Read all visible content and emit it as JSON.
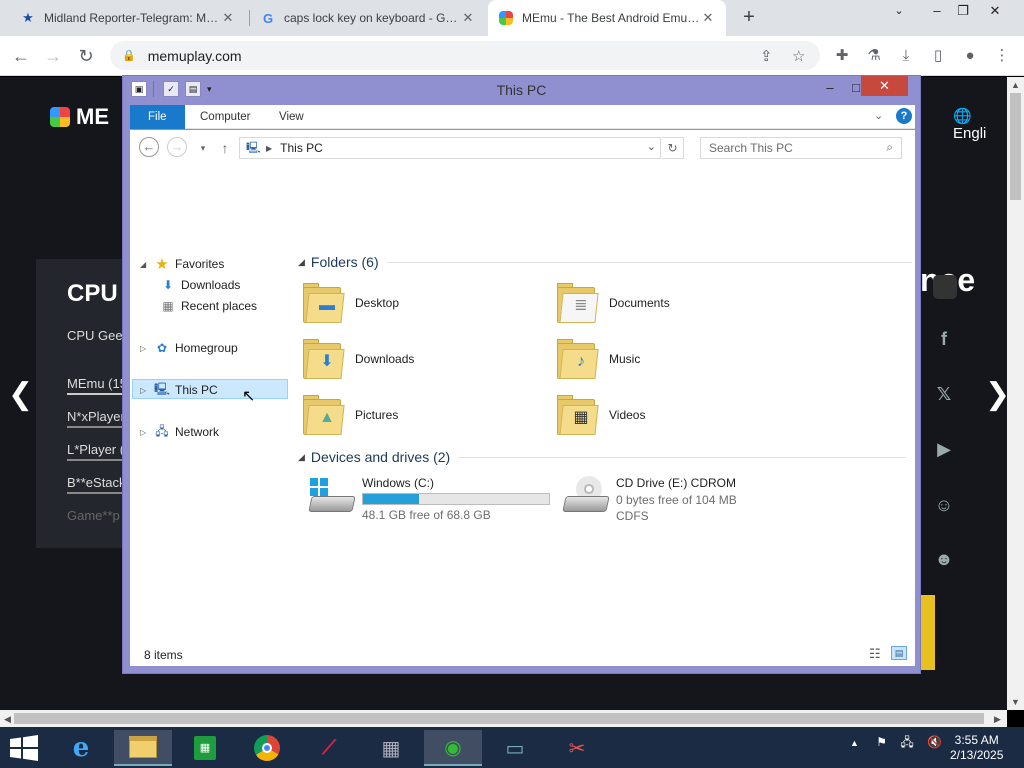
{
  "browser": {
    "tabs": [
      {
        "title": "Midland Reporter-Telegram: Midland news",
        "favicon": "star-icon",
        "color": "#1a4fa0"
      },
      {
        "title": "caps lock key on keyboard - Google Search",
        "favicon": "google-icon",
        "color": "#4285f4"
      },
      {
        "title": "MEmu - The Best Android Emulator",
        "favicon": "memu-icon",
        "color": "#7b4dd6"
      }
    ],
    "url": "memuplay.com"
  },
  "page": {
    "logo": "ME",
    "language": "Engli",
    "cpu_title": "CPU",
    "cpu_subtitle": "CPU Geek",
    "cpu_rows": [
      "MEmu (15",
      "N*xPlayer",
      "L*Player (",
      "B**eStack",
      "Game**p"
    ],
    "big_word": "nce"
  },
  "explorer": {
    "title": "This PC",
    "ribbon_tabs": [
      "File",
      "Computer",
      "View"
    ],
    "address": "This PC",
    "search_placeholder": "Search This PC",
    "nav": {
      "favorites": "Favorites",
      "downloads": "Downloads",
      "recent": "Recent places",
      "homegroup": "Homegroup",
      "this_pc": "This PC",
      "network": "Network"
    },
    "folders_header": "Folders (6)",
    "folders": [
      "Desktop",
      "Documents",
      "Downloads",
      "Music",
      "Pictures",
      "Videos"
    ],
    "devices_header": "Devices and drives (2)",
    "drives": [
      {
        "name": "Windows (C:)",
        "detail": "48.1 GB free of 68.8 GB",
        "used_fraction": 0.3
      },
      {
        "name": "CD Drive (E:) CDROM",
        "detail": "0 bytes free of 104 MB",
        "fs": "CDFS"
      }
    ],
    "status": "8 items"
  },
  "taskbar": {
    "time": "3:55 AM",
    "date": "2/13/2025"
  }
}
